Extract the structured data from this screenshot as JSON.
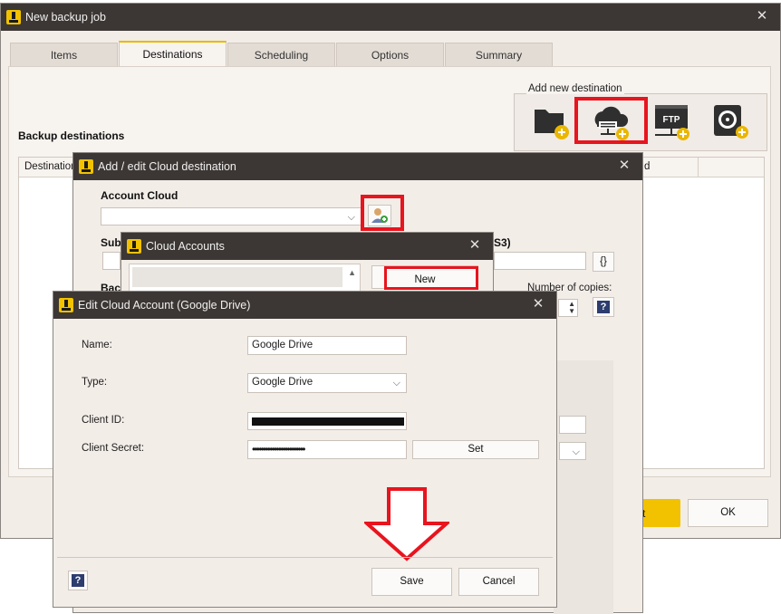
{
  "main_window": {
    "title": "New backup job",
    "close": "✕"
  },
  "tabs": [
    "Items",
    "Destinations",
    "Scheduling",
    "Options",
    "Summary"
  ],
  "add_new_destination": {
    "label": "Add new destination",
    "icons": [
      "folder-add-icon",
      "cloud-add-icon",
      "ftp-add-icon",
      "disk-add-icon"
    ],
    "ftp_text": "FTP"
  },
  "backup_destinations": {
    "label": "Backup destinations",
    "col_destination": "Destination",
    "col_right": "d"
  },
  "footer": {
    "ok": "OK",
    "start_fragment": "t"
  },
  "cloud_dest_dialog": {
    "title": "Add / edit Cloud destination",
    "account_cloud_label": "Account Cloud",
    "subfolder_fragment": "Sub",
    "right_fragment": "S3)",
    "backup_fragment": "Bac",
    "braces": "{}",
    "number_of_copies_label": "Number of copies:",
    "help": "?"
  },
  "cloud_accounts_dialog": {
    "title": "Cloud Accounts",
    "new_button": "New"
  },
  "edit_dialog": {
    "title": "Edit Cloud Account (Google Drive)",
    "name_label": "Name:",
    "name_value": "Google Drive",
    "type_label": "Type:",
    "type_value": "Google Drive",
    "client_id_label": "Client ID:",
    "client_secret_label": "Client Secret:",
    "client_secret_value": "••••••••••••••••••••••••",
    "set_button": "Set",
    "save_button": "Save",
    "cancel_button": "Cancel",
    "help": "?"
  },
  "colors": {
    "accent": "#f2c200",
    "highlight": "#e8141e",
    "titlebar": "#3c3734"
  }
}
